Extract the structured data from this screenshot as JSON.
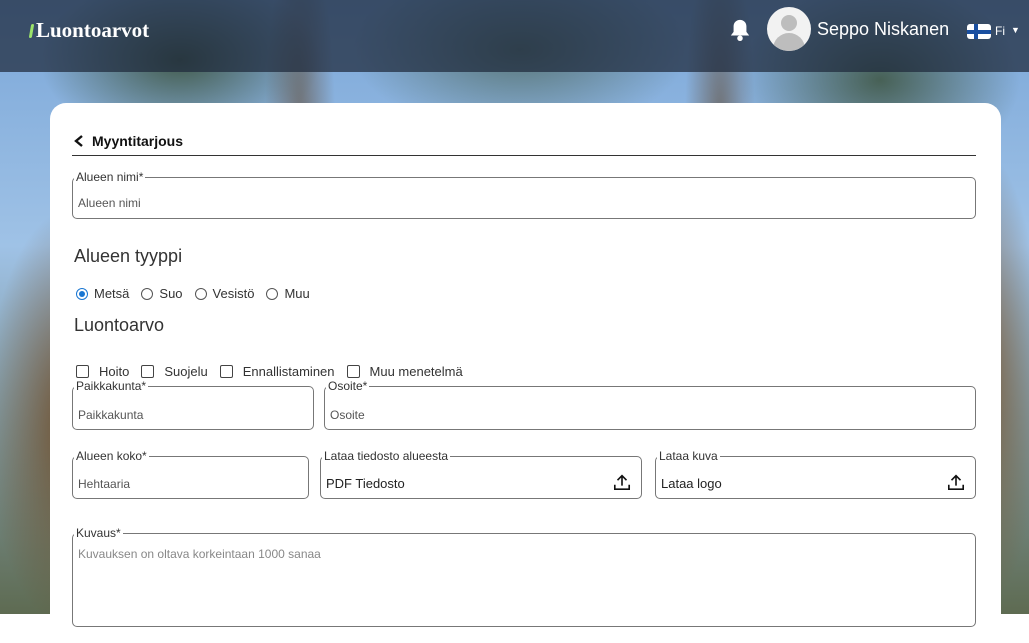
{
  "app": {
    "logo_text": "Luontoarvot"
  },
  "header": {
    "user_name": "Seppo Niskanen",
    "language": "Fi",
    "icons": [
      "bell-icon",
      "avatar",
      "finland-flag-icon",
      "chevron-down-icon"
    ]
  },
  "page": {
    "back_label": "Myyntitarjous"
  },
  "fields": {
    "area_name": {
      "label": "Alueen nimi*",
      "placeholder": "Alueen nimi"
    },
    "municipality": {
      "label": "Paikkakunta*",
      "placeholder": "Paikkakunta"
    },
    "address": {
      "label": "Osoite*",
      "placeholder": "Osoite"
    },
    "area_size": {
      "label": "Alueen koko*",
      "placeholder": "Hehtaaria"
    },
    "area_file": {
      "label": "Lataa tiedosto alueesta",
      "value": "PDF Tiedosto"
    },
    "image": {
      "label": "Lataa kuva",
      "value": "Lataa logo"
    },
    "description": {
      "label": "Kuvaus*",
      "placeholder": "Kuvauksen on oltava korkeintaan 1000 sanaa"
    }
  },
  "area_type": {
    "title": "Alueen tyyppi",
    "options": [
      "Metsä",
      "Suo",
      "Vesistö",
      "Muu"
    ],
    "selected": "Metsä"
  },
  "nature_value": {
    "title": "Luontoarvo",
    "options": [
      "Hoito",
      "Suojelu",
      "Ennallistaminen",
      "Muu menetelmä"
    ]
  },
  "colors": {
    "accent": "#1976d2",
    "header_overlay": "#1e2a3c"
  }
}
